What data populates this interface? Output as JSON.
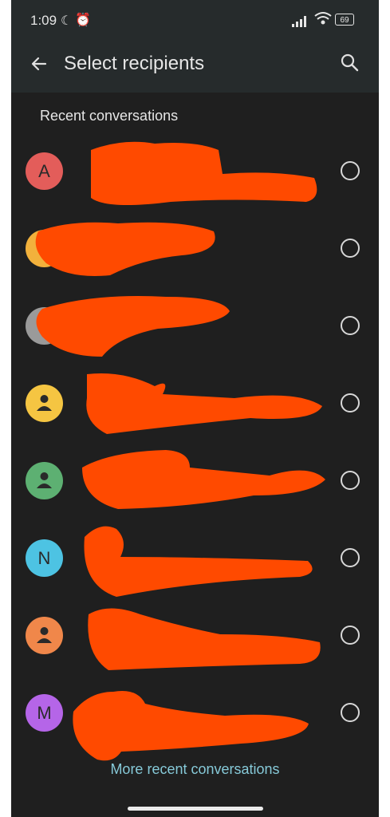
{
  "status": {
    "time": "1:09",
    "battery": "69"
  },
  "appbar": {
    "title": "Select recipients"
  },
  "section_label": "Recent conversations",
  "contacts": [
    {
      "avatar_text": "A",
      "avatar_color": "#e35d5a",
      "avatar_type": "letter"
    },
    {
      "avatar_text": "",
      "avatar_color": "#f2b13c",
      "avatar_type": "photo"
    },
    {
      "avatar_text": "",
      "avatar_color": "#9a9a9a",
      "avatar_type": "photo"
    },
    {
      "avatar_text": "",
      "avatar_color": "#f5c542",
      "avatar_type": "person"
    },
    {
      "avatar_text": "",
      "avatar_color": "#5db072",
      "avatar_type": "person"
    },
    {
      "avatar_text": "N",
      "avatar_color": "#4dc3e3",
      "avatar_type": "letter"
    },
    {
      "avatar_text": "",
      "avatar_color": "#f0874a",
      "avatar_type": "person"
    },
    {
      "avatar_text": "M",
      "avatar_color": "#b565e8",
      "avatar_type": "letter"
    }
  ],
  "more_link": "More recent conversations",
  "colors": {
    "redaction": "#ff4a00",
    "background": "#1f1f1f",
    "link": "#86c9d8"
  }
}
